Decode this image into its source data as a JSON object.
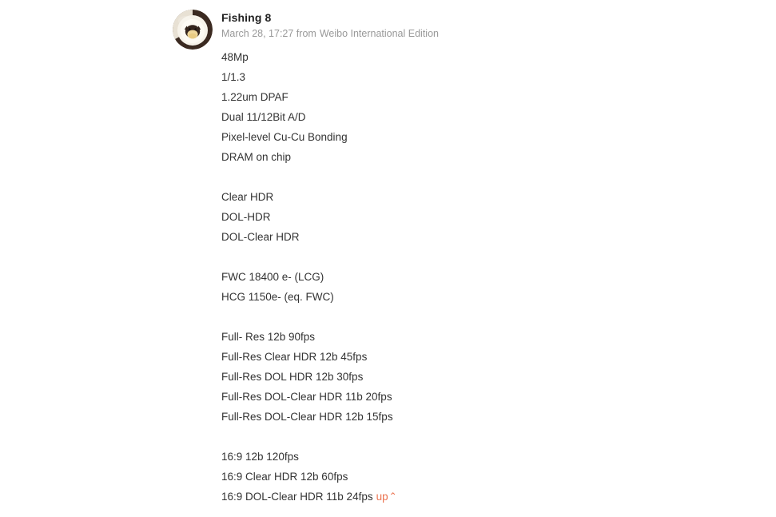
{
  "post": {
    "avatar": {
      "icon": "cat-avatar-icon",
      "alt": "Fishing 8 profile photo",
      "ring_color": "#3b2a21",
      "inner_color": "#f6f1e7",
      "face_color": "#3a2b22",
      "muzzle_color": "#f2d89a"
    },
    "username": "Fishing 8",
    "meta": {
      "timestamp": "March 28, 17:27 from",
      "source": "Weibo International Edition"
    },
    "content_lines": [
      "48Mp",
      "1/1.3",
      "1.22um DPAF",
      "Dual 11/12Bit A/D",
      "Pixel-level Cu-Cu Bonding",
      "DRAM on chip",
      "",
      "Clear HDR",
      "DOL-HDR",
      "DOL-Clear HDR",
      "",
      "FWC 18400 e- (LCG)",
      "HCG 1150e- (eq. FWC)",
      "",
      "Full- Res 12b 90fps",
      "Full-Res Clear HDR 12b 45fps",
      "Full-Res DOL HDR 12b 30fps",
      "Full-Res DOL-Clear HDR 11b 20fps",
      "Full-Res DOL-Clear HDR 12b 15fps",
      "",
      "16:9 12b 120fps",
      "16:9 Clear HDR 12b 60fps",
      "16:9 DOL-Clear HDR 11b 24fps"
    ],
    "collapse": {
      "label": "up",
      "caret": "⌃",
      "color": "#eb7350"
    }
  }
}
